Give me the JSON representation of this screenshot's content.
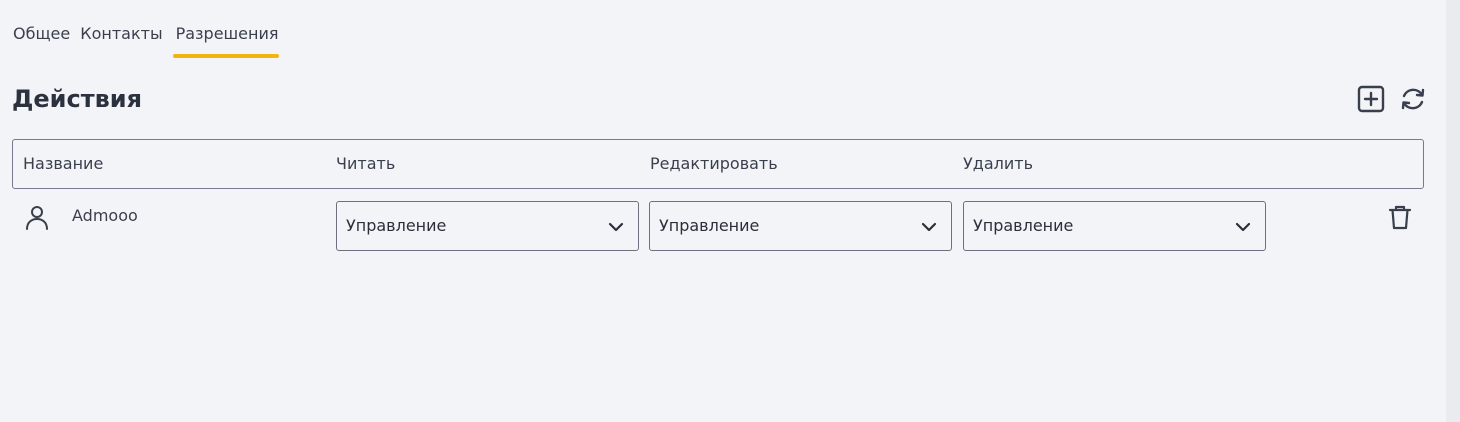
{
  "tabs": [
    {
      "label": "Общее",
      "active": false
    },
    {
      "label": "Контакты",
      "active": false
    },
    {
      "label": "Разрешения",
      "active": true
    }
  ],
  "section": {
    "title": "Действия",
    "add_icon": "plus-square-icon",
    "refresh_icon": "refresh-icon"
  },
  "table": {
    "headers": [
      "Название",
      "Читать",
      "Редактировать",
      "Удалить"
    ],
    "rows": [
      {
        "icon": "user-icon",
        "name": "Admooo",
        "read": "Управление",
        "edit": "Управление",
        "delete": "Управление",
        "remove_icon": "trash-icon"
      }
    ]
  },
  "colors": {
    "accent": "#f4b40c",
    "background": "#f3f4f8",
    "border": "#77798e",
    "text": "#2b2f3a"
  }
}
